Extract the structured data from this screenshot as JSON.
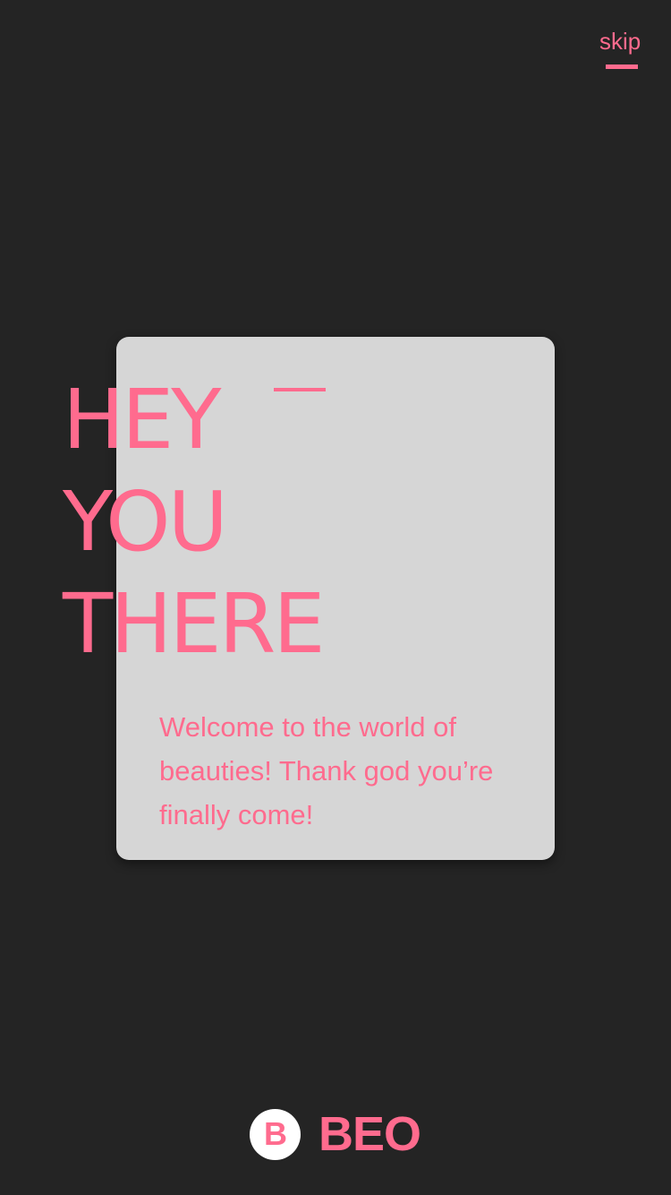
{
  "colors": {
    "background": "#242424",
    "card": "#d6d6d6",
    "accent": "#ff6b8e",
    "logo_background": "#ffffff"
  },
  "top_bar": {
    "skip_label": "skip"
  },
  "headline": {
    "lines": [
      "HEY",
      "YOU",
      "THERE"
    ]
  },
  "welcome": {
    "text": "Welcome to the world of beauties! Thank god you’re finally come!"
  },
  "brand": {
    "logo_letter": "B",
    "logo_icon": "beo-logo-icon",
    "name": "BEO"
  }
}
